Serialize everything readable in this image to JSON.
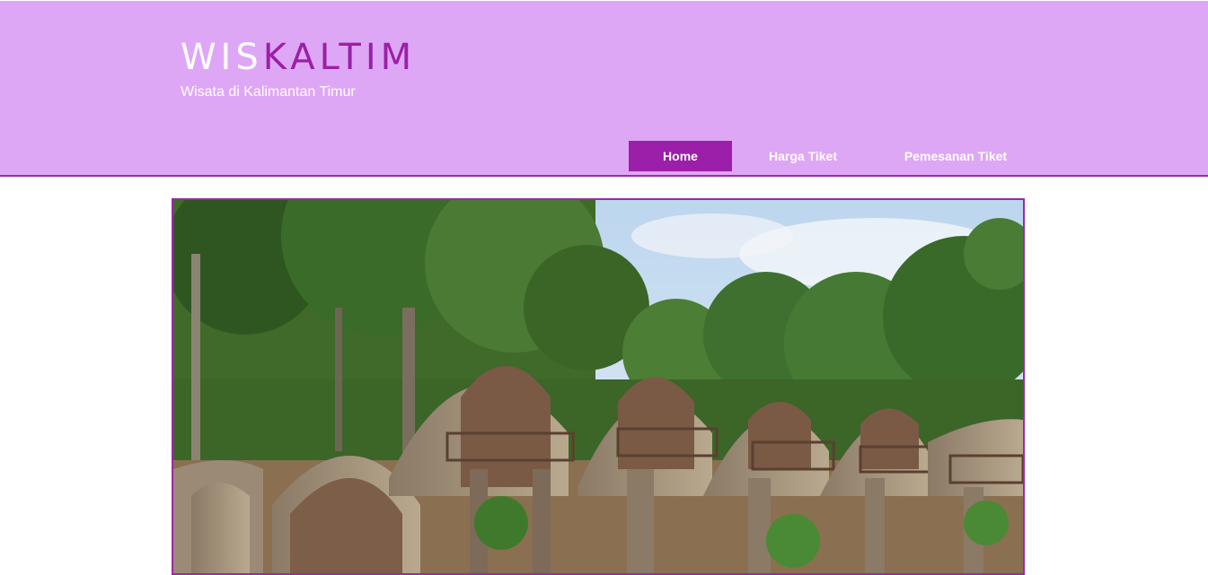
{
  "site": {
    "logo_part1": "WIS",
    "logo_part2": "KALTIM",
    "tagline": "Wisata di Kalimantan Timur"
  },
  "nav": {
    "items": [
      {
        "label": "Home",
        "active": true
      },
      {
        "label": "Harga Tiket",
        "active": false
      },
      {
        "label": "Pemesanan Tiket",
        "active": false
      }
    ]
  },
  "colors": {
    "header_bg": "#dea7f5",
    "accent": "#9b1fa8",
    "text_light": "#ffffff"
  }
}
